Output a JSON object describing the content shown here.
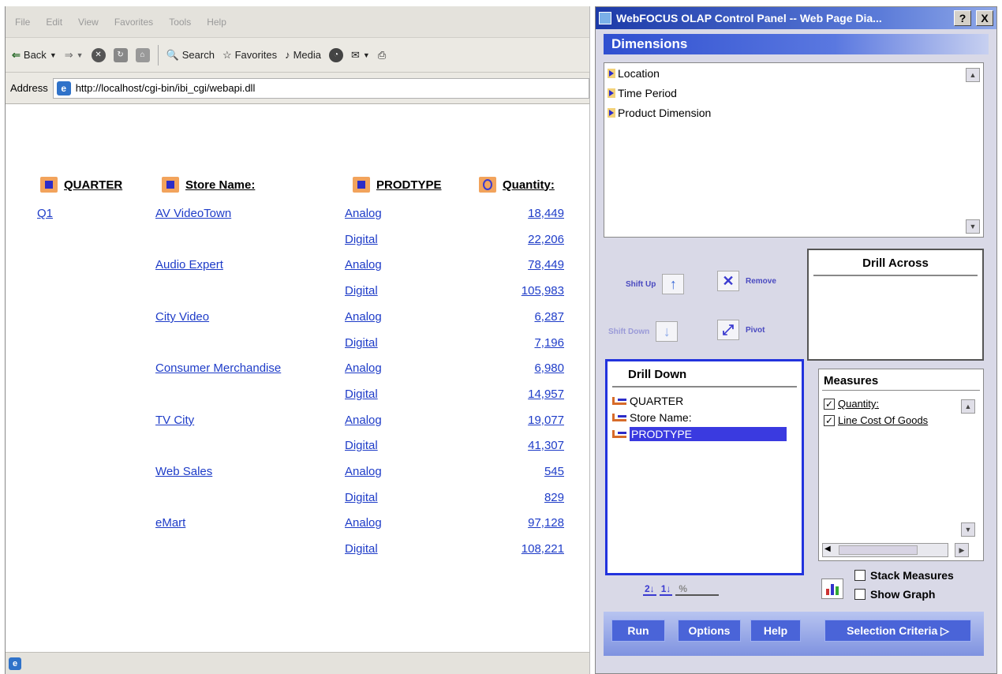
{
  "browser": {
    "menu": [
      "File",
      "Edit",
      "View",
      "Favorites",
      "Tools",
      "Help"
    ],
    "toolbar": {
      "back": "Back",
      "search": "Search",
      "favorites": "Favorites",
      "media": "Media"
    },
    "address_label": "Address",
    "url": "http://localhost/cgi-bin/ibi_cgi/webapi.dll"
  },
  "report": {
    "headers": {
      "quarter": "QUARTER",
      "store": "Store Name:",
      "prodtype": "PRODTYPE",
      "quantity": "Quantity:"
    },
    "quarter": "Q1",
    "rows": [
      {
        "store": "AV VideoTown",
        "prodtype": "Analog",
        "quantity": "18,449"
      },
      {
        "store": "",
        "prodtype": "Digital",
        "quantity": "22,206"
      },
      {
        "store": "Audio Expert",
        "prodtype": "Analog",
        "quantity": "78,449"
      },
      {
        "store": "",
        "prodtype": "Digital",
        "quantity": "105,983"
      },
      {
        "store": "City Video",
        "prodtype": "Analog",
        "quantity": "6,287"
      },
      {
        "store": "",
        "prodtype": "Digital",
        "quantity": "7,196"
      },
      {
        "store": "Consumer Merchandise",
        "prodtype": "Analog",
        "quantity": "6,980"
      },
      {
        "store": "",
        "prodtype": "Digital",
        "quantity": "14,957"
      },
      {
        "store": "TV City",
        "prodtype": "Analog",
        "quantity": "19,077"
      },
      {
        "store": "",
        "prodtype": "Digital",
        "quantity": "41,307"
      },
      {
        "store": "Web Sales",
        "prodtype": "Analog",
        "quantity": "545"
      },
      {
        "store": "",
        "prodtype": "Digital",
        "quantity": "829"
      },
      {
        "store": "eMart",
        "prodtype": "Analog",
        "quantity": "97,128"
      },
      {
        "store": "",
        "prodtype": "Digital",
        "quantity": "108,221"
      }
    ]
  },
  "panel": {
    "title": "WebFOCUS OLAP Control Panel -- Web Page Dia...",
    "help_btn": "?",
    "close_btn": "X",
    "dimensions_head": "Dimensions",
    "dimensions": [
      "Location",
      "Time Period",
      "Product Dimension"
    ],
    "controls": {
      "shift_up": "Shift Up",
      "remove": "Remove",
      "shift_down": "Shift Down",
      "pivot": "Pivot"
    },
    "drill_across": "Drill Across",
    "drill_down": "Drill Down",
    "drill_down_items": [
      "QUARTER",
      "Store Name:",
      "PRODTYPE"
    ],
    "measures_head": "Measures",
    "measures": [
      "Quantity:",
      "Line Cost Of Goods"
    ],
    "stack_measures": "Stack Measures",
    "show_graph": "Show Graph",
    "sort_buttons": [
      "2↓",
      "1↓",
      "%"
    ],
    "buttons": {
      "run": "Run",
      "options": "Options",
      "help": "Help",
      "selection": "Selection Criteria ▷"
    }
  }
}
